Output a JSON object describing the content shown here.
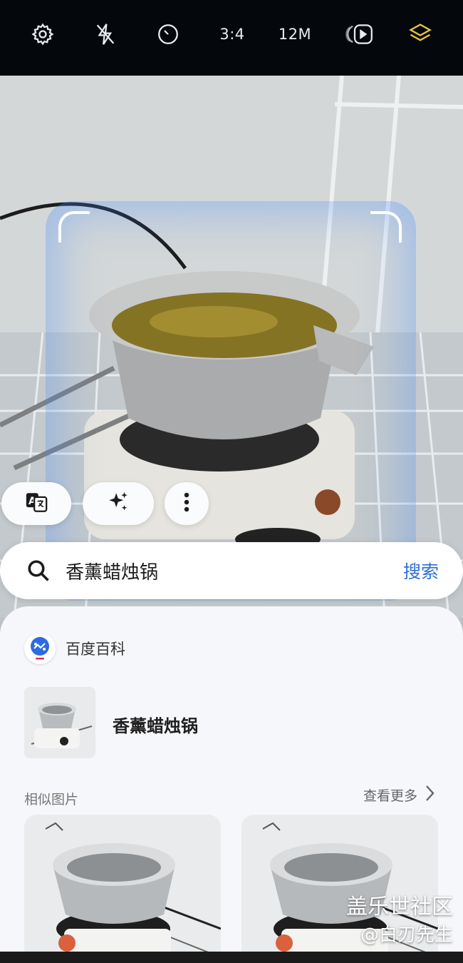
{
  "top_bar": {
    "icons": [
      "settings-gear-icon",
      "flash-off-icon",
      "timer-icon",
      "motion-photo-icon",
      "layers-icon"
    ],
    "aspect_ratio": "3:4",
    "resolution": "12M",
    "accent_color": "#e8c53a"
  },
  "actions": {
    "icons": [
      "translate-icon",
      "ai-sparkle-icon",
      "more-vert-icon"
    ]
  },
  "search": {
    "query": "香薰蜡烛锅",
    "button_label": "搜索",
    "button_color": "#2f6fd6"
  },
  "result": {
    "source_name": "百度百科",
    "entry_title": "香薰蜡烛锅"
  },
  "similar": {
    "label": "相似图片",
    "more_label": "查看更多"
  },
  "watermark": {
    "line1": "盖乐世社区",
    "line2": "@白刃先生"
  }
}
